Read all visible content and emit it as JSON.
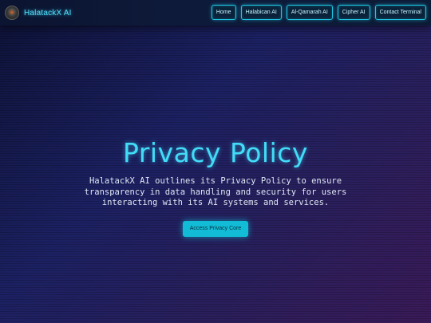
{
  "brand": {
    "name": "HalatackX AI",
    "logo_icon": "avatar-icon"
  },
  "nav": {
    "items": [
      {
        "label": "Home"
      },
      {
        "label": "Halabican AI"
      },
      {
        "label": "Al-Qamarah AI"
      },
      {
        "label": "Cipher AI"
      },
      {
        "label": "Contact Terminal"
      }
    ]
  },
  "hero": {
    "title": "Privacy Policy",
    "description": "HalatackX AI outlines its Privacy Policy to ensure transparency in data handling and security for users interacting with its AI systems and services.",
    "cta_label": "Access Privacy Core"
  },
  "colors": {
    "accent": "#42dcf8",
    "button": "#12bcd6",
    "background_start": "#0d1236",
    "background_end": "#3a1a58"
  }
}
